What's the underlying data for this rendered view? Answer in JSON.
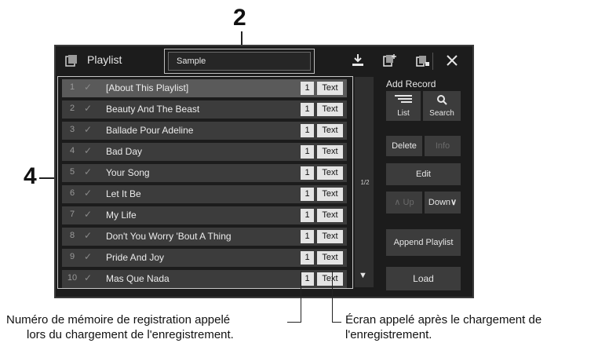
{
  "callouts": {
    "top": "2",
    "left": "4"
  },
  "window": {
    "title": "Playlist",
    "name_value": "Sample"
  },
  "icons": [
    "playlist-icon",
    "save-icon",
    "add-playlist-icon",
    "bank-icon",
    "close-icon"
  ],
  "rows": [
    {
      "num": "1",
      "title": "[About This Playlist]",
      "mem": "1",
      "text": "Text"
    },
    {
      "num": "2",
      "title": "Beauty And The Beast",
      "mem": "1",
      "text": "Text"
    },
    {
      "num": "3",
      "title": "Ballade Pour Adeline",
      "mem": "1",
      "text": "Text"
    },
    {
      "num": "4",
      "title": "Bad Day",
      "mem": "1",
      "text": "Text"
    },
    {
      "num": "5",
      "title": "Your Song",
      "mem": "1",
      "text": "Text"
    },
    {
      "num": "6",
      "title": "Let It Be",
      "mem": "1",
      "text": "Text"
    },
    {
      "num": "7",
      "title": "My Life",
      "mem": "1",
      "text": "Text"
    },
    {
      "num": "8",
      "title": "Don't You Worry 'Bout A Thing",
      "mem": "1",
      "text": "Text"
    },
    {
      "num": "9",
      "title": "Pride And Joy",
      "mem": "1",
      "text": "Text"
    },
    {
      "num": "10",
      "title": "Mas Que Nada",
      "mem": "1",
      "text": "Text"
    }
  ],
  "page_indicator": "1/2",
  "panel": {
    "add_record": "Add Record",
    "list": "List",
    "search": "Search",
    "delete": "Delete",
    "info": "Info",
    "edit": "Edit",
    "up": "Up",
    "down": "Down",
    "append": "Append Playlist",
    "load": "Load"
  },
  "captions": {
    "left_1": "Numéro de mémoire de registration appelé",
    "left_2": "lors du chargement de l'enregistrement.",
    "right_1": "Écran appelé après le chargement de",
    "right_2": "l'enregistrement."
  }
}
